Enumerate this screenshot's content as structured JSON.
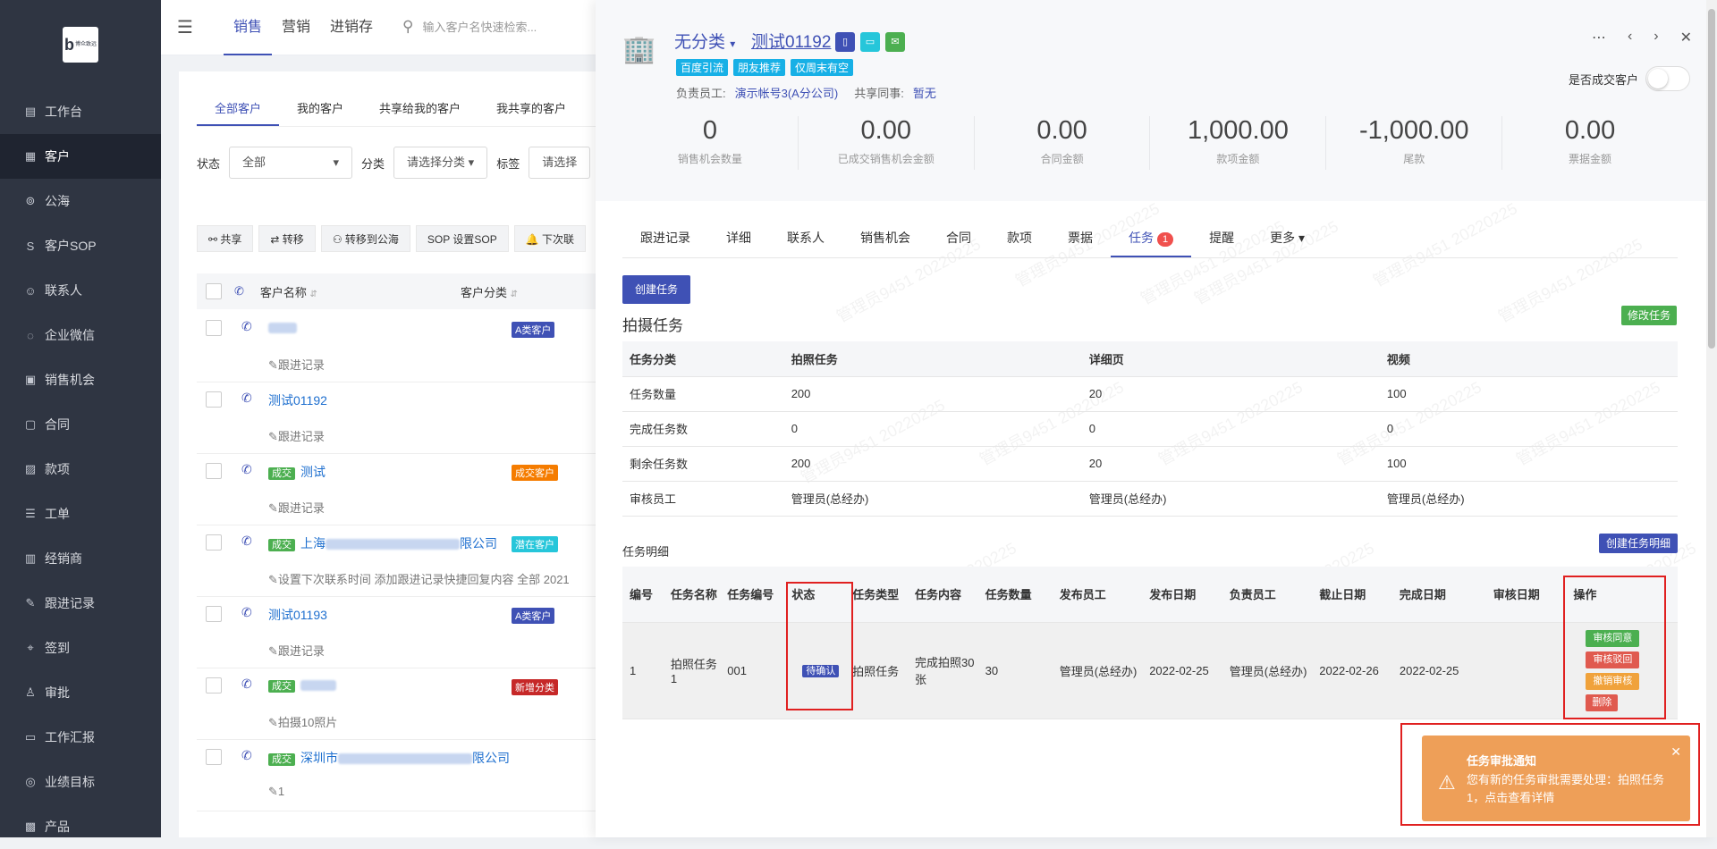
{
  "sidebar": {
    "logo_text": "博众致远",
    "items": [
      {
        "label": "工作台",
        "icon": "dashboard-icon"
      },
      {
        "label": "客户",
        "icon": "building-icon",
        "active": true
      },
      {
        "label": "公海",
        "icon": "sea-icon"
      },
      {
        "label": "客户SOP",
        "icon": "sop-icon"
      },
      {
        "label": "联系人",
        "icon": "person-icon"
      },
      {
        "label": "企业微信",
        "icon": "wechat-icon"
      },
      {
        "label": "销售机会",
        "icon": "bag-icon"
      },
      {
        "label": "合同",
        "icon": "contract-icon"
      },
      {
        "label": "款项",
        "icon": "payment-icon"
      },
      {
        "label": "工单",
        "icon": "ticket-icon"
      },
      {
        "label": "经销商",
        "icon": "dealer-icon"
      },
      {
        "label": "跟进记录",
        "icon": "edit-icon"
      },
      {
        "label": "签到",
        "icon": "location-icon"
      },
      {
        "label": "审批",
        "icon": "approval-icon"
      },
      {
        "label": "工作汇报",
        "icon": "report-icon"
      },
      {
        "label": "业绩目标",
        "icon": "target-icon"
      },
      {
        "label": "产品",
        "icon": "product-icon"
      }
    ]
  },
  "topbar": {
    "tabs": [
      "销售",
      "营销",
      "进销存"
    ],
    "active_tab": 0,
    "search_placeholder": "输入客户名快速检索..."
  },
  "list": {
    "tabs": [
      "全部客户",
      "我的客户",
      "共享给我的客户",
      "我共享的客户"
    ],
    "filters": {
      "status_label": "状态",
      "status_value": "全部",
      "category_label": "分类",
      "category_value": "请选择分类",
      "tag_label": "标签",
      "tag_value": "请选择"
    },
    "actions": [
      "共享",
      "转移",
      "转移到公海",
      "设置SOP",
      "下次联"
    ],
    "columns": [
      "客户名称",
      "客户分类"
    ],
    "rows": [
      {
        "name": "",
        "deal": "",
        "sub": "跟进记录",
        "category": "A类客户",
        "cat_color": "#3f51b5"
      },
      {
        "name": "测试01192",
        "deal": "",
        "sub": "跟进记录",
        "category": "",
        "cat_color": ""
      },
      {
        "name": "测试",
        "deal": "成交",
        "sub": "跟进记录",
        "category": "成交客户",
        "cat_color": "#f57c00"
      },
      {
        "name": "限公司",
        "deal": "成交",
        "name_prefix": "上海",
        "sub": "设置下次联系时间 添加跟进记录快捷回复内容 全部 2021",
        "category": "潜在客户",
        "cat_color": "#26c6da"
      },
      {
        "name": "测试01193",
        "deal": "",
        "sub": "跟进记录",
        "category": "A类客户",
        "cat_color": "#3f51b5"
      },
      {
        "name": "",
        "deal": "成交",
        "sub": "拍摄10照片",
        "category": "新增分类",
        "cat_color": "#c62828"
      },
      {
        "name": "限公司",
        "deal": "成交",
        "name_prefix": "深圳市",
        "sub": "1",
        "category": "",
        "cat_color": ""
      }
    ]
  },
  "drawer": {
    "category": "无分类",
    "customer_name": "测试01192",
    "tags": [
      "百度引流",
      "朋友推荐",
      "仅周末有空"
    ],
    "staff_label": "负责员工:",
    "staff_value": "演示帐号3(A分公司)",
    "share_label": "共享同事:",
    "share_value": "暂无",
    "deal_switch_label": "是否成交客户",
    "stats": [
      {
        "value": "0",
        "label": "销售机会数量"
      },
      {
        "value": "0.00",
        "label": "已成交销售机会金额"
      },
      {
        "value": "0.00",
        "label": "合同金额"
      },
      {
        "value": "1,000.00",
        "label": "款项金额"
      },
      {
        "value": "-1,000.00",
        "label": "尾款"
      },
      {
        "value": "0.00",
        "label": "票据金额"
      }
    ],
    "tabs": [
      "跟进记录",
      "详细",
      "联系人",
      "销售机会",
      "合同",
      "款项",
      "票据",
      "任务",
      "提醒",
      "更多"
    ],
    "active_tab": "任务",
    "task_badge": "1",
    "create_task": "创建任务",
    "edit_task": "修改任务",
    "section_title": "拍摄任务",
    "summary": {
      "headers": [
        "任务分类",
        "拍照任务",
        "详细页",
        "视频"
      ],
      "rows": [
        [
          "任务数量",
          "200",
          "20",
          "100"
        ],
        [
          "完成任务数",
          "0",
          "0",
          "0"
        ],
        [
          "剩余任务数",
          "200",
          "20",
          "100"
        ],
        [
          "审核员工",
          "管理员(总经办)",
          "管理员(总经办)",
          "管理员(总经办)"
        ]
      ]
    },
    "detail_title": "任务明细",
    "create_detail": "创建任务明细",
    "detail": {
      "headers": [
        "编号",
        "任务名称",
        "任务编号",
        "状态",
        "任务类型",
        "任务内容",
        "任务数量",
        "发布员工",
        "发布日期",
        "负责员工",
        "截止日期",
        "完成日期",
        "审核日期",
        "操作"
      ],
      "row": {
        "no": "1",
        "name": "拍照任务1",
        "code": "001",
        "status": "待确认",
        "type": "拍照任务",
        "content": "完成拍照30张",
        "qty": "30",
        "publisher": "管理员(总经办)",
        "pub_date": "2022-02-25",
        "owner": "管理员(总经办)",
        "due": "2022-02-26",
        "done": "2022-02-25",
        "audit": ""
      },
      "ops": [
        {
          "label": "审核同意",
          "color": "#4caf50"
        },
        {
          "label": "审核驳回",
          "color": "#e05a4f"
        },
        {
          "label": "撤销审核",
          "color": "#f0a23b"
        },
        {
          "label": "删除",
          "color": "#e05a4f"
        }
      ]
    },
    "watermark": "管理员9451 20220225"
  },
  "toast": {
    "title": "任务审批通知",
    "message": "您有新的任务审批需要处理：拍照任务1，点击查看详情"
  }
}
